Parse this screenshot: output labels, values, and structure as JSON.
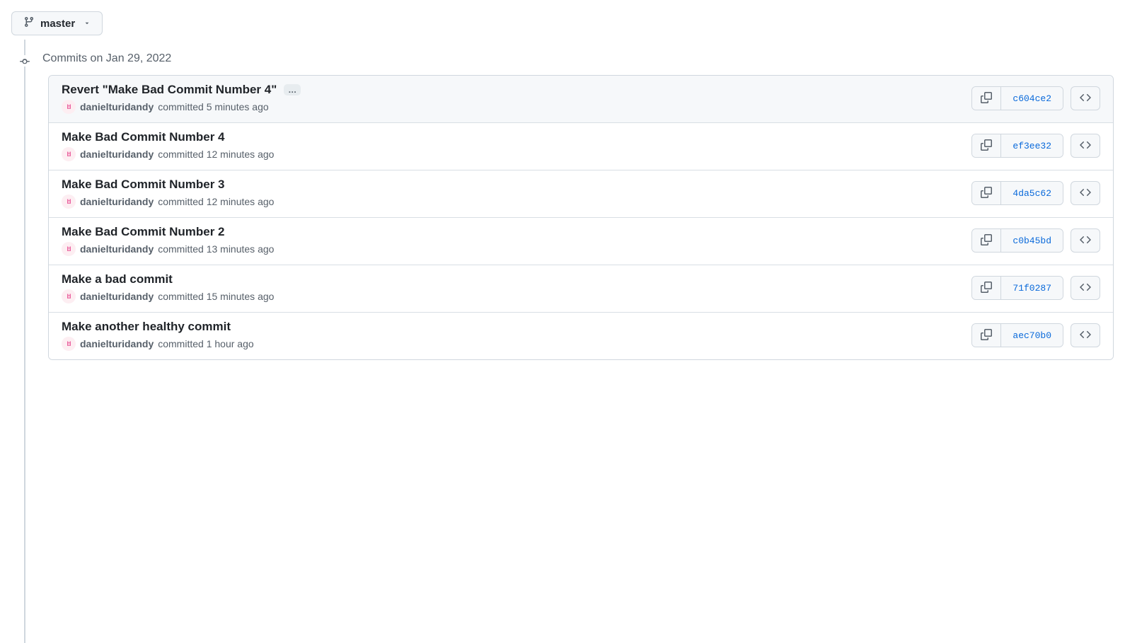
{
  "branch": {
    "name": "master"
  },
  "section": {
    "heading": "Commits on Jan 29, 2022"
  },
  "commits": [
    {
      "title": "Revert \"Make Bad Commit Number 4\"",
      "showEllipsis": true,
      "author": "danielturidandy",
      "meta": "committed 5 minutes ago",
      "sha": "c604ce2",
      "highlighted": true
    },
    {
      "title": "Make Bad Commit Number 4",
      "showEllipsis": false,
      "author": "danielturidandy",
      "meta": "committed 12 minutes ago",
      "sha": "ef3ee32",
      "highlighted": false
    },
    {
      "title": "Make Bad Commit Number 3",
      "showEllipsis": false,
      "author": "danielturidandy",
      "meta": "committed 12 minutes ago",
      "sha": "4da5c62",
      "highlighted": false
    },
    {
      "title": "Make Bad Commit Number 2",
      "showEllipsis": false,
      "author": "danielturidandy",
      "meta": "committed 13 minutes ago",
      "sha": "c0b45bd",
      "highlighted": false
    },
    {
      "title": "Make a bad commit",
      "showEllipsis": false,
      "author": "danielturidandy",
      "meta": "committed 15 minutes ago",
      "sha": "71f0287",
      "highlighted": false
    },
    {
      "title": "Make another healthy commit",
      "showEllipsis": false,
      "author": "danielturidandy",
      "meta": "committed 1 hour ago",
      "sha": "aec70b0",
      "highlighted": false
    }
  ],
  "avatarGlyph": "I:I"
}
